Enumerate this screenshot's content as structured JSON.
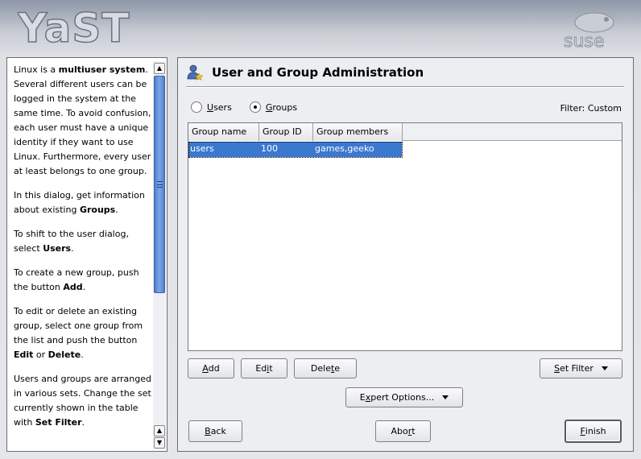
{
  "header": {
    "logo_text": "YaST",
    "brand_text": "suse"
  },
  "help": {
    "paragraphs": [
      [
        {
          "t": "Linux is a "
        },
        {
          "b": "multiuser system"
        },
        {
          "t": ". Several different users can be logged in the system at the same time. To avoid confusion, each user must have a unique identity if they want to use Linux. Furthermore, every user at least belongs to one group."
        }
      ],
      [
        {
          "t": "In this dialog, get information about existing "
        },
        {
          "b": "Groups"
        },
        {
          "t": "."
        }
      ],
      [
        {
          "t": "To shift to the user dialog, select "
        },
        {
          "b": "Users"
        },
        {
          "t": "."
        }
      ],
      [
        {
          "t": "To create a new group, push the button "
        },
        {
          "b": "Add"
        },
        {
          "t": "."
        }
      ],
      [
        {
          "t": "To edit or delete an existing group, select one group from the list and push the button "
        },
        {
          "b": "Edit"
        },
        {
          "t": " or "
        },
        {
          "b": "Delete"
        },
        {
          "t": "."
        }
      ],
      [
        {
          "t": "Users and groups are arranged in various sets. Change the set currently shown in the table with "
        },
        {
          "b": "Set Filter"
        },
        {
          "t": "."
        }
      ]
    ]
  },
  "main": {
    "title": "User and Group Administration",
    "radios": [
      {
        "label": "Users",
        "underline": "U",
        "rest": "sers",
        "checked": false
      },
      {
        "label": "Groups",
        "underline": "G",
        "rest": "roups",
        "checked": true
      }
    ],
    "filter_label": "Filter: Custom",
    "table": {
      "columns": [
        "Group name",
        "Group ID",
        "Group members"
      ],
      "rows": [
        {
          "name": "users",
          "id": "100",
          "members": "games,geeko",
          "selected": true
        }
      ]
    },
    "buttons": {
      "add": {
        "u": "A",
        "rest": "dd"
      },
      "edit": {
        "pre": "Ed",
        "u": "i",
        "rest": "t"
      },
      "delete": {
        "pre": "Dele",
        "u": "t",
        "rest": "e"
      },
      "set_filter": {
        "pre": "",
        "u": "S",
        "rest": "et Filter"
      },
      "expert": {
        "pre": "E",
        "u": "x",
        "rest": "pert Options..."
      },
      "back": {
        "u": "B",
        "rest": "ack"
      },
      "abort": {
        "pre": "Abo",
        "u": "r",
        "rest": "t"
      },
      "finish": {
        "u": "F",
        "rest": "inish"
      }
    }
  },
  "colors": {
    "selection": "#3b78cf",
    "scroll_thumb": "#5b8ad8"
  }
}
